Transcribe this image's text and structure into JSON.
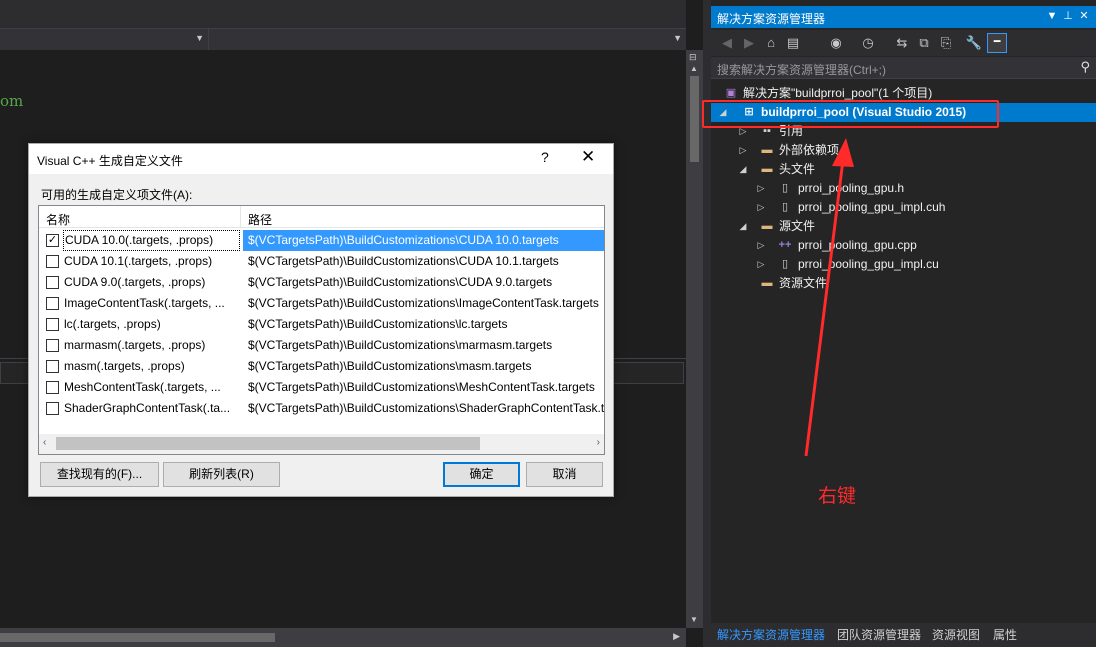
{
  "editor": {
    "code_fragment": "om"
  },
  "solution_explorer": {
    "title": "解决方案资源管理器",
    "title_buttons": [
      "▼",
      "📌",
      "✕"
    ],
    "search_placeholder": "搜索解决方案资源管理器(Ctrl+;)",
    "tree": {
      "solution": "解决方案\"buildprroi_pool\"(1 个项目)",
      "project": "buildprroi_pool (Visual Studio 2015)",
      "references": "引用",
      "external_deps": "外部依赖项",
      "header_folder": "头文件",
      "header_files": [
        "prroi_pooling_gpu.h",
        "prroi_pooling_gpu_impl.cuh"
      ],
      "source_folder": "源文件",
      "source_files": [
        "prroi_pooling_gpu.cpp",
        "prroi_pooling_gpu_impl.cu"
      ],
      "resource_folder": "资源文件"
    },
    "bottom_tabs": [
      "解决方案资源管理器",
      "团队资源管理器",
      "资源视图",
      "属性"
    ]
  },
  "dialog": {
    "title": "Visual C++ 生成自定义文件",
    "help": "?",
    "close": "✕",
    "caption": "可用的生成自定义项文件(A):",
    "columns": [
      "名称",
      "路径"
    ],
    "rows": [
      {
        "name": "CUDA 10.0(.targets, .props)",
        "path": "$(VCTargetsPath)\\BuildCustomizations\\CUDA 10.0.targets",
        "checked": "✓"
      },
      {
        "name": "CUDA 10.1(.targets, .props)",
        "path": "$(VCTargetsPath)\\BuildCustomizations\\CUDA 10.1.targets",
        "checked": ""
      },
      {
        "name": "CUDA 9.0(.targets, .props)",
        "path": "$(VCTargetsPath)\\BuildCustomizations\\CUDA 9.0.targets",
        "checked": ""
      },
      {
        "name": "ImageContentTask(.targets, ...",
        "path": "$(VCTargetsPath)\\BuildCustomizations\\ImageContentTask.targets",
        "checked": ""
      },
      {
        "name": "lc(.targets, .props)",
        "path": "$(VCTargetsPath)\\BuildCustomizations\\lc.targets",
        "checked": ""
      },
      {
        "name": "marmasm(.targets, .props)",
        "path": "$(VCTargetsPath)\\BuildCustomizations\\marmasm.targets",
        "checked": ""
      },
      {
        "name": "masm(.targets, .props)",
        "path": "$(VCTargetsPath)\\BuildCustomizations\\masm.targets",
        "checked": ""
      },
      {
        "name": "MeshContentTask(.targets, ...",
        "path": "$(VCTargetsPath)\\BuildCustomizations\\MeshContentTask.targets",
        "checked": ""
      },
      {
        "name": "ShaderGraphContentTask(.ta...",
        "path": "$(VCTargetsPath)\\BuildCustomizations\\ShaderGraphContentTask.targets",
        "checked": ""
      }
    ],
    "buttons": {
      "find": "查找现有的(F)...",
      "refresh": "刷新列表(R)",
      "ok": "确定",
      "cancel": "取消"
    }
  },
  "annotation": {
    "note": "右键",
    "color": "#ff2a2a"
  }
}
